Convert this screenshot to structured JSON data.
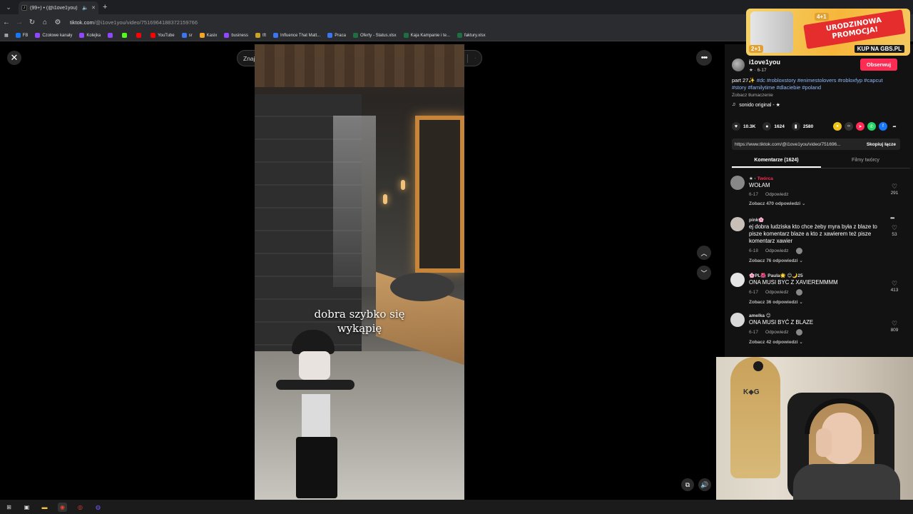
{
  "browser": {
    "tab_title": "(99+) • (@i1ove1you) | Ti",
    "url_host": "tiktok.com",
    "url_path": "/@i1ove1you/video/7516964188372159766",
    "bookmarks": [
      {
        "label": "FB",
        "color": "#1877f2"
      },
      {
        "label": "Czołowe kanały",
        "color": "#9146ff"
      },
      {
        "label": "Kolejka",
        "color": "#9146ff"
      },
      {
        "label": "",
        "color": "#9146ff"
      },
      {
        "label": "",
        "color": "#53fc18"
      },
      {
        "label": "",
        "color": "#ff0000"
      },
      {
        "label": "YouTube",
        "color": "#ff0000"
      },
      {
        "label": "sr",
        "color": "#3a76f0"
      },
      {
        "label": "Kasix",
        "color": "#f5a623"
      },
      {
        "label": "business",
        "color": "#9146ff"
      },
      {
        "label": "tft",
        "color": "#c9a227"
      },
      {
        "label": "Influence That Matt...",
        "color": "#3a76f0"
      },
      {
        "label": "Praca",
        "color": "#3a76f0"
      },
      {
        "label": "Oferty - Status.xlsx",
        "color": "#1d6f42"
      },
      {
        "label": "Kaja Kampanie i te...",
        "color": "#1d6f42"
      },
      {
        "label": "faktury.xlsx",
        "color": "#1d6f42"
      }
    ]
  },
  "search": {
    "placeholder": "Znajdź powiązane treści"
  },
  "video": {
    "caption_line1": "dobra szybko się",
    "caption_line2": "wykąpię"
  },
  "promo": {
    "line1": "URODZINOWA",
    "line2": "PROMOCJA!",
    "shop": "KUP NA GBS.PL",
    "badge1": "4+1",
    "badge2": "2+1"
  },
  "author": {
    "name": "i1ove1you",
    "sub": "★ · 6-17",
    "follow_label": "Obserwuj"
  },
  "description": {
    "prefix": "part 27✨ ",
    "tags": "#dc #robloxstory #enimestolovers #robloxfyp #capcut #story #familytime #dlaciebie #poland",
    "translate": "Zobacz tłumaczenie",
    "music": "sonido original - ★"
  },
  "stats": {
    "likes": "10.3K",
    "comments": "1624",
    "saves": "2580"
  },
  "share": {
    "link": "https://www.tiktok.com/@i1ove1you/video/751696...",
    "copy_label": "Skopiuj łącze"
  },
  "tabs": {
    "comments": "Komentarze (1624)",
    "creator_videos": "Filmy twórcy"
  },
  "reply_label": "Odpowiedz",
  "comments": [
    {
      "user": "★ · ",
      "creator_tag": "Twórca",
      "text": "WOŁAM",
      "date": "6-17",
      "views": "Zobacz 470 odpowiedzi ⌄",
      "likes": "291",
      "avatar": "#888"
    },
    {
      "user": "pink🌸",
      "creator_tag": "",
      "text": "ej dobra ludziska kto chce żeby myra była z blaze to pisze komentarz blaze a kto z xawierem też pisze komentarz xawier",
      "date": "6-18",
      "views": "Zobacz 76 odpowiedzi ⌄",
      "likes": "53",
      "avatar": "#c8c0b8"
    },
    {
      "user": "🌸PL🌺 Paula🌟 😊🌙25",
      "creator_tag": "",
      "text": "ONA MUSI BYC Z XAVIEREMMMM",
      "date": "6-17",
      "views": "Zobacz 36 odpowiedzi ⌄",
      "likes": "413",
      "avatar": "#e5e5e5"
    },
    {
      "user": "amelka 😊",
      "creator_tag": "",
      "text": "ONA MUSI BYĆ Z BLAZE",
      "date": "6-17",
      "views": "Zobacz 42 odpowiedzi ⌄",
      "likes": "809",
      "avatar": "#d9d9d9"
    }
  ],
  "colors": {
    "accent": "#fe2c55",
    "tag": "#8fb8ff"
  }
}
